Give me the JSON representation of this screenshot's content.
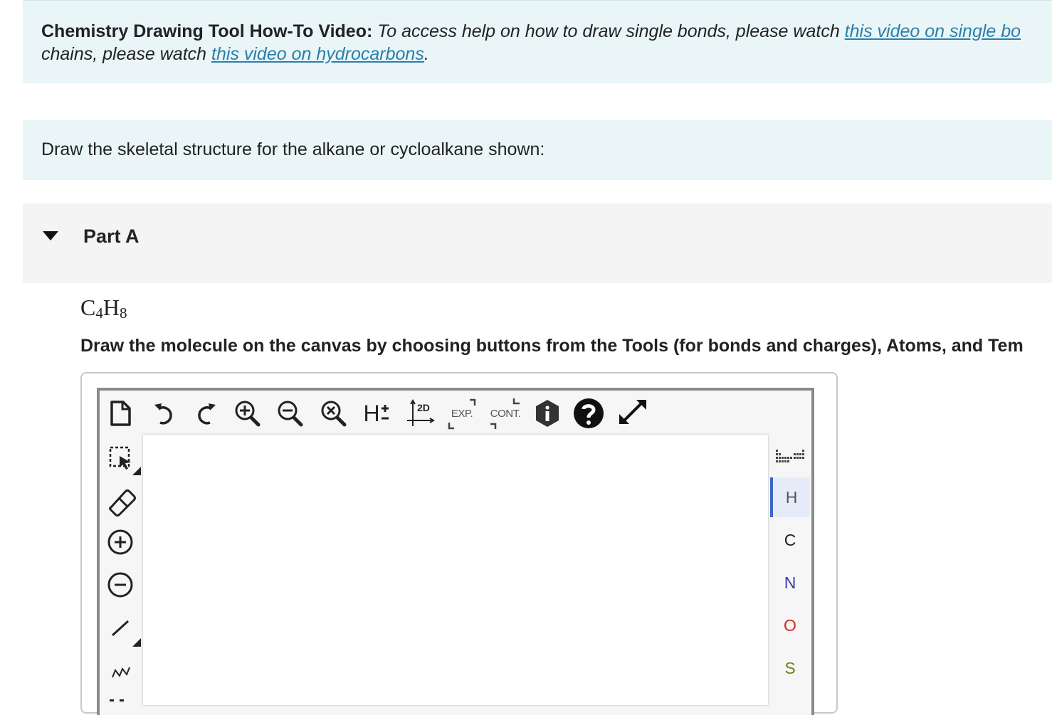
{
  "help": {
    "label": "Chemistry Drawing Tool How-To Video:",
    "text_1": " To access help on how to draw single bonds, please watch ",
    "link_1": "this video on single bo",
    "text_2": "chains, please watch ",
    "link_2": "this video on hydrocarbons",
    "text_3": "."
  },
  "instruction": "Draw the skeletal structure for the alkane or cycloalkane shown:",
  "part": {
    "title": "Part A"
  },
  "formula": {
    "c": "C",
    "c_sub": "4",
    "h": "H",
    "h_sub": "8"
  },
  "directions": "Draw the molecule on the canvas by choosing buttons from the Tools (for bonds and charges), Atoms, and Tem",
  "toolbar": {
    "twod_label": "2D",
    "exp_label": "EXP.",
    "cont_label": "CONT.",
    "h_label": "H"
  },
  "atoms": [
    {
      "symbol": "H",
      "color": "#555555"
    },
    {
      "symbol": "C",
      "color": "#222222"
    },
    {
      "symbol": "N",
      "color": "#3a3aa8"
    },
    {
      "symbol": "O",
      "color": "#d0281e"
    },
    {
      "symbol": "S",
      "color": "#7a7a1e"
    }
  ],
  "colors": {
    "accent": "#3a66c9",
    "link": "#2a7fa9",
    "panel_bg": "#e9f5f7"
  }
}
